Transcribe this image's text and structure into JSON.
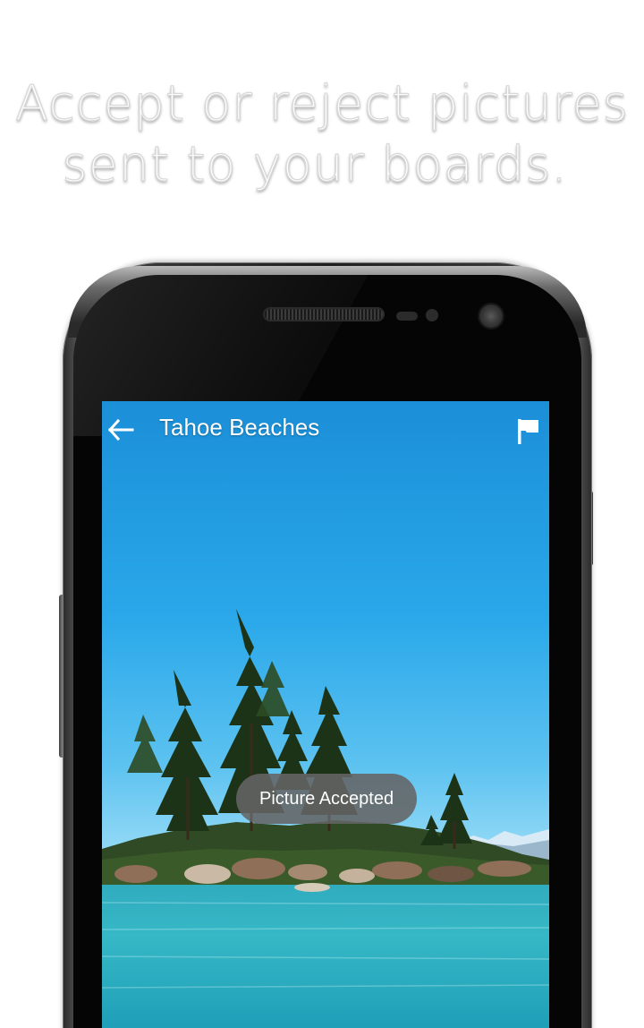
{
  "headline": {
    "line1": "Accept or reject pictures",
    "line2": "sent to your boards."
  },
  "app_bar": {
    "title": "Tahoe Beaches",
    "back_icon": "arrow-back-icon",
    "action_icon": "flag-icon"
  },
  "toast": {
    "message": "Picture Accepted"
  },
  "colors": {
    "sky_top": "#1a8fd9",
    "sky_bottom": "#7fd0f5",
    "water": "#2bb5c6",
    "toast_bg": "#646464",
    "text": "#ffffff"
  }
}
